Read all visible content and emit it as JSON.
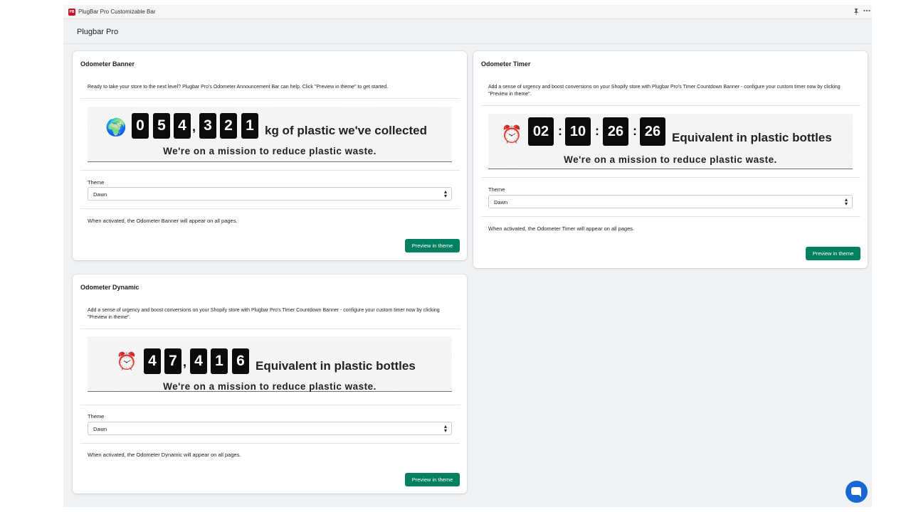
{
  "window": {
    "app_name": "PlugBar Pro Customizable Bar",
    "icon_text": "PB"
  },
  "header": {
    "title": "Plugbar Pro"
  },
  "cards": {
    "banner": {
      "title": "Odometer Banner",
      "description": "Ready to take your store to the next level? Plugbar Pro's Odometer Announcement Bar can help. Click \"Preview in theme\" to get started.",
      "preview": {
        "emoji": "🌍",
        "digits": [
          "0",
          "5",
          "4",
          "3",
          "2",
          "1"
        ],
        "separator": ",",
        "headline": "kg of plastic we've collected",
        "tagline": "We're on a mission to reduce plastic waste."
      },
      "theme_label": "Theme",
      "theme_value": "Dawn",
      "activation_text": "When activated, the Odometer Banner will appear on all pages.",
      "button_label": "Preview in theme"
    },
    "timer": {
      "title": "Odometer Timer",
      "description": "Add a sense of urgency and boost conversions on your Shopify store with Plugbar Pro's Timer Countdown Banner - configure your custom timer now by clicking \"Preview in theme\".",
      "preview": {
        "emoji": "⏰",
        "digits": [
          "02",
          "10",
          "26",
          "26"
        ],
        "separator": ":",
        "headline": "Equivalent in plastic bottles",
        "tagline": "We're on a mission to reduce plastic waste."
      },
      "theme_label": "Theme",
      "theme_value": "Dawn",
      "activation_text": "When activated, the Odometer Timer will appear on all pages.",
      "button_label": "Preview in theme"
    },
    "dynamic": {
      "title": "Odometer Dynamic",
      "description": "Add a sense of urgency and boost conversions on your Shopify store with Plugbar Pro's Timer Countdown Banner - configure your custom timer now by clicking \"Preview in theme\".",
      "preview": {
        "emoji": "⏰",
        "digits": [
          "4",
          "7",
          "4",
          "1",
          "6"
        ],
        "separator": ",",
        "headline": "Equivalent in plastic bottles",
        "tagline": "We're on a mission to reduce plastic waste."
      },
      "theme_label": "Theme",
      "theme_value": "Dawn",
      "activation_text": "When activated, the Odometer Dynamic will appear on all pages.",
      "button_label": "Preview in theme"
    }
  },
  "icons": {
    "pin": "pin-icon",
    "more": "more-horizontal-icon",
    "chat": "chat-icon"
  },
  "colors": {
    "primary_button": "#008060",
    "chat_bubble": "#1769d1",
    "app_icon": "#c8102e"
  }
}
